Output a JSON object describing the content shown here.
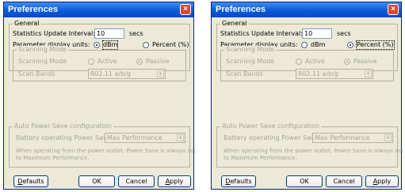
{
  "dialogs": [
    {
      "title": "Preferences",
      "close_glyph": "×",
      "general_title": "General",
      "stats_label": "Statistics Update Interval:",
      "stats_value": "10",
      "stats_unit": "secs",
      "units_label": "Parameter display units:",
      "opt_dbm": "dBm",
      "opt_percent": "Percent (%)",
      "selected_unit": "dBm",
      "scan_title": "Scanning Mode",
      "scan_mode_label": "Scanning Mode",
      "opt_active": "Active",
      "opt_passive": "Passive",
      "scan_bands_label": "Scan Bands",
      "scan_bands_value": "802.11 a/b/g",
      "arrow_glyph": "▾",
      "aps_title": "Auto Power Save configuration",
      "battery_label": "Battery operating Power Save:",
      "battery_value": "Max Performance",
      "note_line1": "When operating from the power outlet, Power Save is always set",
      "note_line2": "to Maximum Performance.",
      "btn_defaults": "Defaults",
      "btn_ok": "OK",
      "btn_cancel": "Cancel",
      "btn_apply": "Apply"
    },
    {
      "title": "Preferences",
      "close_glyph": "×",
      "general_title": "General",
      "stats_label": "Statistics Update Interval:",
      "stats_value": "10",
      "stats_unit": "secs",
      "units_label": "Parameter display units:",
      "opt_dbm": "dBm",
      "opt_percent": "Percent (%)",
      "selected_unit": "Percent (%)",
      "scan_title": "Scanning Mode",
      "scan_mode_label": "Scanning Mode",
      "opt_active": "Active",
      "opt_passive": "Passive",
      "scan_bands_label": "Scan Bands",
      "scan_bands_value": "802.11 a/b/g",
      "arrow_glyph": "▾",
      "aps_title": "Auto Power Save configuration",
      "battery_label": "Battery operating Power Save:",
      "battery_value": "Max Performance",
      "note_line1": "When operating from the power outlet, Power Save is always set",
      "note_line2": "to Maximum Performance.",
      "btn_defaults": "Defaults",
      "btn_ok": "OK",
      "btn_cancel": "Cancel",
      "btn_apply": "Apply"
    }
  ],
  "colors": {
    "title_bar": "#0a5ad8",
    "dialog_face": "#ece9d8",
    "disabled_text": "#a7a59a",
    "close_button": "#d84b2c"
  }
}
